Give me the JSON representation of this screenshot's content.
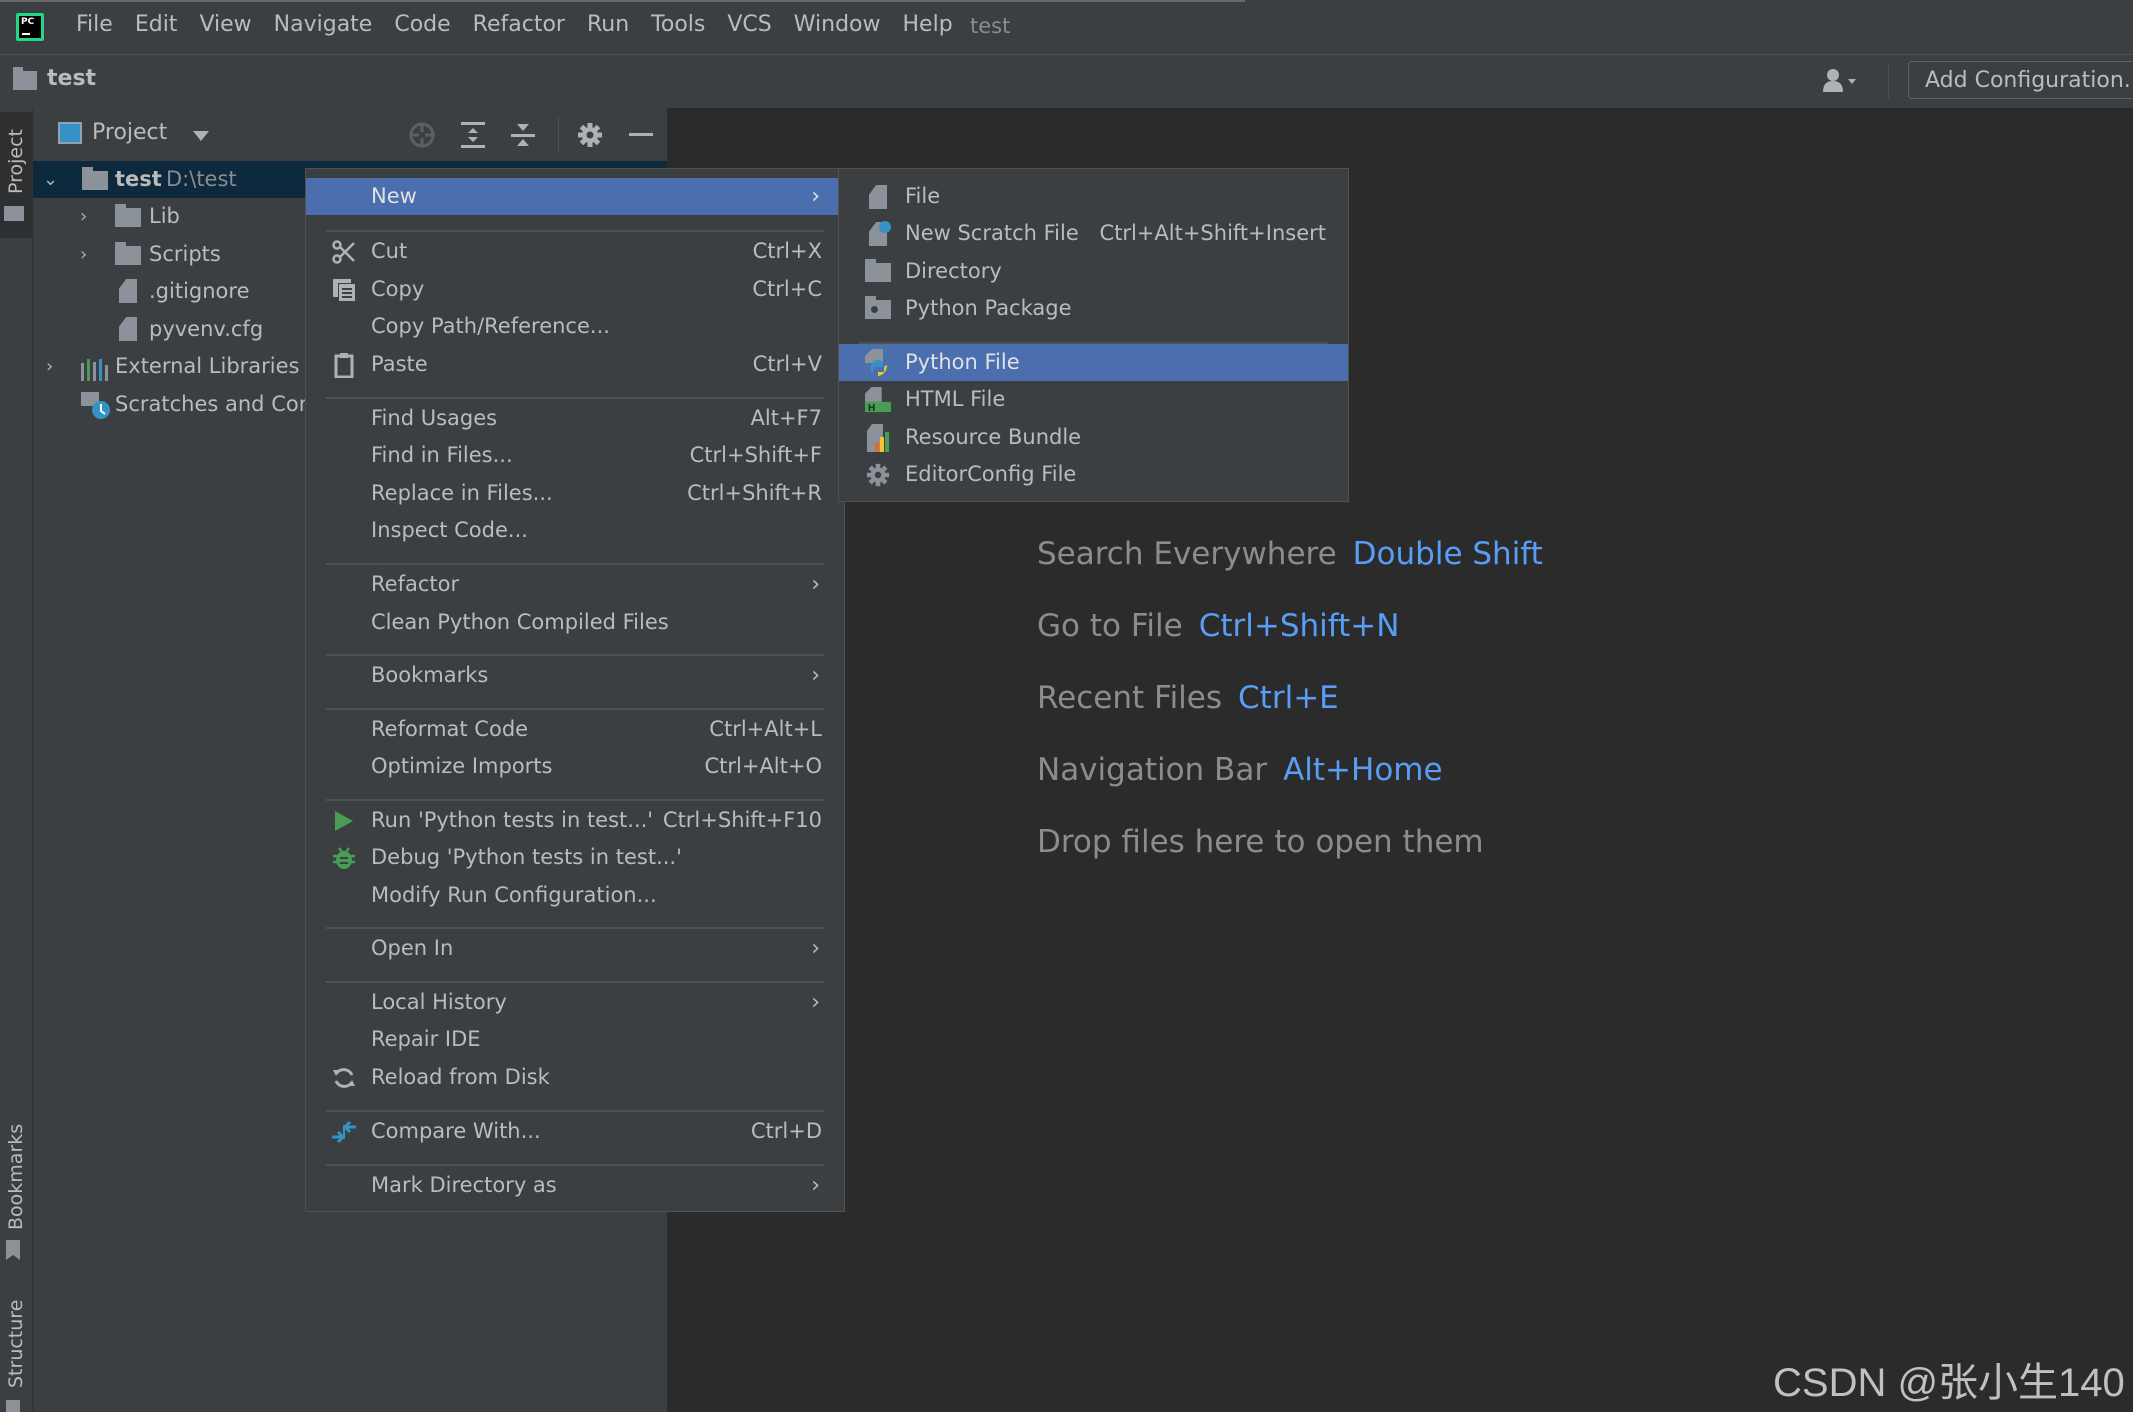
{
  "menubar": {
    "items": [
      "File",
      "Edit",
      "View",
      "Navigate",
      "Code",
      "Refactor",
      "Run",
      "Tools",
      "VCS",
      "Window",
      "Help"
    ],
    "window_title": "test"
  },
  "navbar": {
    "project_name": "test",
    "add_configuration": "Add Configuration..."
  },
  "left_stripe": {
    "project": "Project",
    "bookmarks": "Bookmarks",
    "structure": "Structure"
  },
  "project_panel": {
    "title": "Project",
    "tree": [
      {
        "name": "test",
        "path": "D:\\test",
        "type": "folder",
        "expanded": true,
        "selected": true
      },
      {
        "name": "Lib",
        "type": "folder",
        "expanded": false
      },
      {
        "name": "Scripts",
        "type": "folder",
        "expanded": false
      },
      {
        "name": ".gitignore",
        "type": "ignore-file"
      },
      {
        "name": "pyvenv.cfg",
        "type": "text-file"
      },
      {
        "name": "External Libraries",
        "type": "libraries",
        "expanded": false
      },
      {
        "name": "Scratches and Consoles",
        "type": "scratches"
      }
    ]
  },
  "context_menu": {
    "items": [
      {
        "label": "New",
        "submenu": true,
        "highlighted": true
      },
      {
        "label": "Cut",
        "shortcut": "Ctrl+X",
        "icon": "scissors-icon"
      },
      {
        "label": "Copy",
        "shortcut": "Ctrl+C",
        "icon": "copy-icon"
      },
      {
        "label": "Copy Path/Reference..."
      },
      {
        "label": "Paste",
        "shortcut": "Ctrl+V",
        "icon": "clipboard-icon"
      },
      {
        "label": "Find Usages",
        "shortcut": "Alt+F7"
      },
      {
        "label": "Find in Files...",
        "shortcut": "Ctrl+Shift+F"
      },
      {
        "label": "Replace in Files...",
        "shortcut": "Ctrl+Shift+R"
      },
      {
        "label": "Inspect Code..."
      },
      {
        "label": "Refactor",
        "submenu": true
      },
      {
        "label": "Clean Python Compiled Files"
      },
      {
        "label": "Bookmarks",
        "submenu": true
      },
      {
        "label": "Reformat Code",
        "shortcut": "Ctrl+Alt+L"
      },
      {
        "label": "Optimize Imports",
        "shortcut": "Ctrl+Alt+O"
      },
      {
        "label": "Run 'Python tests in test...'",
        "shortcut": "Ctrl+Shift+F10",
        "icon": "run-icon"
      },
      {
        "label": "Debug 'Python tests in test...'",
        "icon": "debug-icon"
      },
      {
        "label": "Modify Run Configuration..."
      },
      {
        "label": "Open In",
        "submenu": true
      },
      {
        "label": "Local History",
        "submenu": true
      },
      {
        "label": "Repair IDE"
      },
      {
        "label": "Reload from Disk",
        "icon": "reload-icon"
      },
      {
        "label": "Compare With...",
        "shortcut": "Ctrl+D",
        "icon": "compare-icon"
      },
      {
        "label": "Mark Directory as",
        "submenu": true
      }
    ]
  },
  "new_submenu": {
    "items": [
      {
        "label": "File",
        "icon": "file-icon"
      },
      {
        "label": "New Scratch File",
        "shortcut": "Ctrl+Alt+Shift+Insert",
        "icon": "scratch-file-icon"
      },
      {
        "label": "Directory",
        "icon": "folder-icon"
      },
      {
        "label": "Python Package",
        "icon": "package-icon"
      },
      {
        "label": "Python File",
        "icon": "python-file-icon",
        "highlighted": true
      },
      {
        "label": "HTML File",
        "icon": "html-file-icon"
      },
      {
        "label": "Resource Bundle",
        "icon": "resource-bundle-icon"
      },
      {
        "label": "EditorConfig File",
        "icon": "gear-icon"
      }
    ]
  },
  "editor_hints": [
    {
      "text": "Search Everywhere",
      "key": "Double Shift"
    },
    {
      "text": "Go to File",
      "key": "Ctrl+Shift+N"
    },
    {
      "text": "Recent Files",
      "key": "Ctrl+E"
    },
    {
      "text": "Navigation Bar",
      "key": "Alt+Home"
    },
    {
      "text": "Drop files here to open them",
      "key": ""
    }
  ],
  "watermark": "CSDN @张小生140",
  "colors": {
    "highlight": "#4b6eaf",
    "shortcut_blue": "#589df6",
    "selection": "#0d293e",
    "run_green": "#499c54",
    "compare_blue": "#3592c4"
  }
}
